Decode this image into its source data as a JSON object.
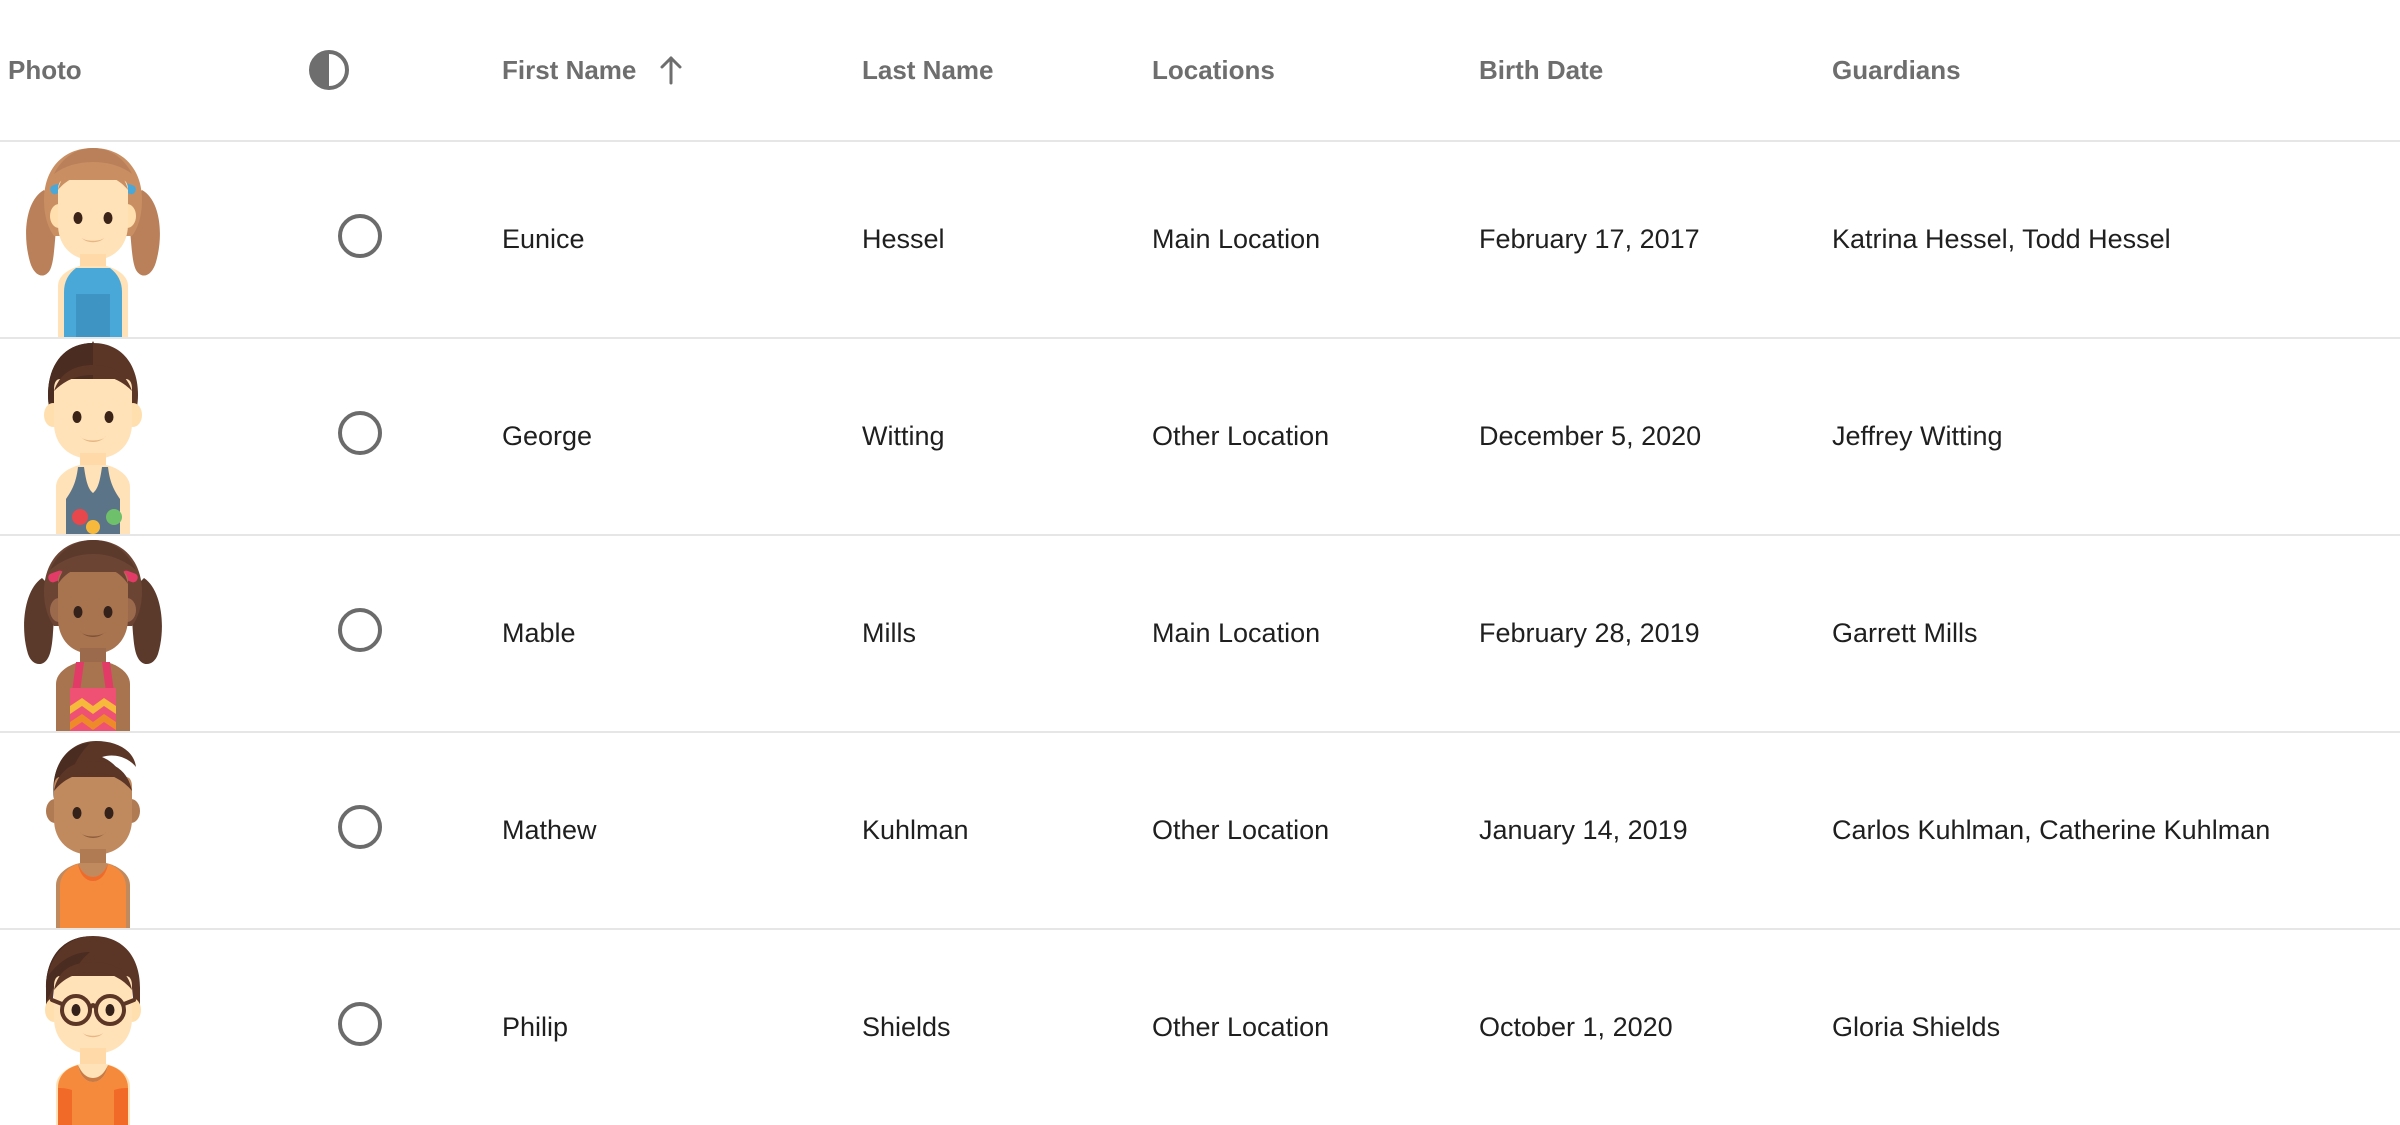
{
  "table": {
    "columns": [
      {
        "key": "photo",
        "label": "Photo",
        "sorted": false
      },
      {
        "key": "select",
        "label": "",
        "icon": "half-circle-select-icon",
        "sorted": false
      },
      {
        "key": "first",
        "label": "First Name",
        "sorted": true,
        "sort_direction": "ascending",
        "sort_icon": "arrow-up-icon"
      },
      {
        "key": "last",
        "label": "Last Name",
        "sorted": false
      },
      {
        "key": "locations",
        "label": "Locations",
        "sorted": false
      },
      {
        "key": "birth",
        "label": "Birth Date",
        "sorted": false
      },
      {
        "key": "guardians",
        "label": "Guardians",
        "sorted": false
      }
    ],
    "rows": [
      {
        "avatar": "girl-pigtails-blue-dress-avatar",
        "selected": false,
        "first_name": "Eunice",
        "last_name": "Hessel",
        "locations": "Main Location",
        "birth_date": "February 17, 2017",
        "guardians": "Katrina Hessel, Todd Hessel"
      },
      {
        "avatar": "boy-spiky-hair-overalls-avatar",
        "selected": false,
        "first_name": "George",
        "last_name": "Witting",
        "locations": "Other Location",
        "birth_date": "December 5, 2020",
        "guardians": "Jeffrey Witting"
      },
      {
        "avatar": "girl-pigtails-chevron-top-avatar",
        "selected": false,
        "first_name": "Mable",
        "last_name": "Mills",
        "locations": "Main Location",
        "birth_date": "February 28, 2019",
        "guardians": "Garrett Mills"
      },
      {
        "avatar": "boy-swept-hair-orange-shirt-avatar",
        "selected": false,
        "first_name": "Mathew",
        "last_name": "Kuhlman",
        "locations": "Other Location",
        "birth_date": "January 14, 2019",
        "guardians": "Carlos Kuhlman, Catherine Kuhlman"
      },
      {
        "avatar": "boy-glasses-orange-shirt-avatar",
        "selected": false,
        "first_name": "Philip",
        "last_name": "Shields",
        "locations": "Other Location",
        "birth_date": "October 1, 2020",
        "guardians": "Gloria Shields"
      }
    ]
  },
  "colors": {
    "header_text": "#6e6e6e",
    "body_text": "#1f1f1f",
    "row_divider": "#e6e6e6",
    "radio_stroke": "#6b6b6b",
    "background": "#ffffff"
  }
}
